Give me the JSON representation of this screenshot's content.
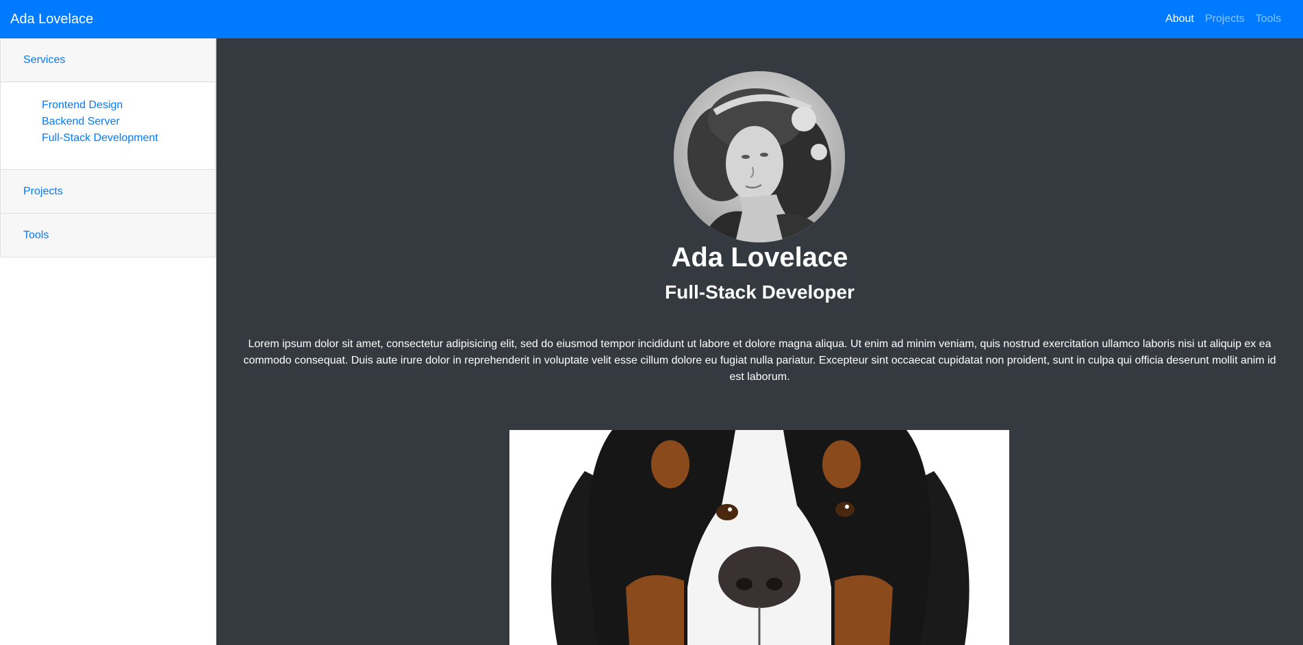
{
  "navbar": {
    "brand": "Ada Lovelace",
    "links": [
      {
        "label": "About",
        "active": true
      },
      {
        "label": "Projects",
        "active": false
      },
      {
        "label": "Tools",
        "active": false
      }
    ]
  },
  "sidebar": {
    "sections": [
      {
        "label": "Services",
        "expanded": true,
        "items": [
          "Frontend Design",
          "Backend Server",
          "Full-Stack Development"
        ]
      },
      {
        "label": "Projects",
        "expanded": false
      },
      {
        "label": "Tools",
        "expanded": false
      }
    ]
  },
  "profile": {
    "name": "Ada Lovelace",
    "title": "Full-Stack Developer",
    "bio": "Lorem ipsum dolor sit amet, consectetur adipisicing elit, sed do eiusmod tempor incididunt ut labore et dolore magna aliqua. Ut enim ad minim veniam, quis nostrud exercitation ullamco laboris nisi ut aliquip ex ea commodo consequat. Duis aute irure dolor in reprehenderit in voluptate velit esse cillum dolore eu fugiat nulla pariatur. Excepteur sint occaecat cupidatat non proident, sunt in culpa qui officia deserunt mollit anim id est laborum."
  },
  "colors": {
    "navbar": "#007bff",
    "link": "#007bff",
    "main_bg": "#343a40",
    "sidebar_header_bg": "#f7f7f7"
  }
}
